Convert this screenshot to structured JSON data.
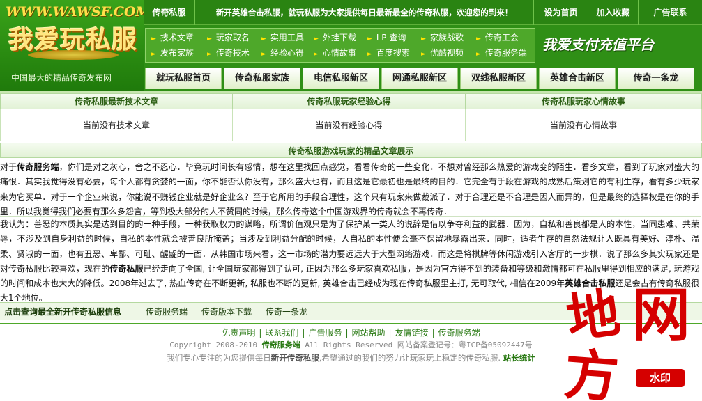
{
  "logo": {
    "url_text": "WWW.WAWSF.COM",
    "title": "我爱玩私服",
    "slogan": "中国最大的精品传奇发布网"
  },
  "topbar": {
    "site_label": "传奇私服",
    "welcome": "新开英雄合击私服，就玩私服为大家提供每日最新最全的传奇私服，欢迎您的到来！",
    "set_home": "设为首页",
    "add_favorite": "加入收藏",
    "ad_contact": "广告联系"
  },
  "nav": {
    "row1": [
      "技术文章",
      "玩家取名",
      "实用工具",
      "外挂下载",
      "I P 查询",
      "家族战歌",
      "传奇工会"
    ],
    "row2": [
      "发布家族",
      "传奇技术",
      "经验心得",
      "心情故事",
      "百度搜索",
      "优酷视频",
      "传奇服务端"
    ]
  },
  "pay_banner": "我爱支付充值平台",
  "tabs": [
    "就玩私服首页",
    "传奇私服家族",
    "电信私服新区",
    "网通私服新区",
    "双线私服新区",
    "英雄合击新区",
    "传奇一条龙"
  ],
  "columns": [
    {
      "title": "传奇私服最新技术文章",
      "empty": "当前没有技术文章"
    },
    {
      "title": "传奇私服玩家经验心得",
      "empty": "当前没有经验心得"
    },
    {
      "title": "传奇私服玩家心情故事",
      "empty": "当前没有心情故事"
    }
  ],
  "showcase": {
    "title": "传奇私服游戏玩家的精品文章展示",
    "para1_prefix": "对于",
    "para1_bold": "传奇服务端",
    "para1_rest": "，你们是对之灰心，舍之不忍心．毕竟玩时间长有感情，想在这里找回点感觉，看看传奇的一些变化．不想对曾经那么热爱的游戏变的陌生．看多文章，看到了玩家对盛大的痛恨．其实我觉得没有必要，每个人都有贪婪的一面，你不能否认你没有，那么盛大也有，而且这是它最初也是最终的目的．它完全有手段在游戏的成熟后策划它的有利生存，看有多少玩家来为它买单．对于一个企业来说，你能说不赚钱企业就是好企业么？至于它所用的手段合理性，这个只有玩家来做裁派了．对于合理还是不合理是因人而异的，但是最终的选择权是在你的手里．所以我觉得我们必要有那么多怨言，等到极大部分的人不赞同的时候，那么传奇这个中国游戏界的传奇就会不再传奇．",
    "para2_a": "我认为：善恶的本质其实是达到目的的一种手段，一种获取权力的谋略，所谓价值观只是为了保护某一类人的说辞是借以争夺利益的武器．因为，自私和善良都是人的本性，当同患难、共荣辱，不涉及到自身利益的时候，自私的本性就会被善良所掩盖；当涉及到利益分配的时候，人自私的本性便会毫不保留地暴露出来．同时，适者生存的自然法规让人既具有美好、淳朴、温柔、贤淑的一面，也有丑恶、卑鄙、可耻、龌龊的一面．从韩国市场来看，这一市场的潜力要远远大于大型网络游戏．而这是将棋牌等休闲游戏引入客厅的一步棋．说了那么多其实玩家还是对传奇私服比较喜欢，现在的",
    "para2_bold1": "传奇私服",
    "para2_b": "已经走向了全国, 让全国玩家都得到了认可, 正因为那么多玩家喜欢私服，是因为官方得不到的装备和等级和激情都可在私服里得到相应的满足, 玩游戏的时间和成本也大大的降低。2008年过去了, 热血传奇在不断更新, 私服也不断的更新, 英雄合击已经成为现在传奇私服里主打, 无可取代, 相信在2009年",
    "para2_bold2": "英雄合击私服",
    "para2_c": "还是会占有传奇私服很大1个地位。"
  },
  "query_bar": {
    "title": "点击查询最全新开传奇私服信息",
    "links": [
      "传奇服务端",
      "传奇版本下载",
      "传奇一条龙"
    ]
  },
  "footer": {
    "links": [
      "免责声明",
      "联系我们",
      "广告服务",
      "网站帮助",
      "友情链接",
      "传奇服务端"
    ],
    "copyright_prefix": "Copyright 2008-2010",
    "copyright_brand": "传奇服务端",
    "copyright_rest": "All Rights Reserved 网站备案登记号：粤ICP备05092447号",
    "support_a": "我们专心专注的为您提供每日",
    "support_bold": "新开传奇私服",
    "support_b": ",希望通过的我们的努力让玩家玩上稳定的传奇私服.",
    "stats_link": "站长统计"
  },
  "watermark": {
    "chars": [
      "地",
      "网",
      "方"
    ],
    "stamp": "水印"
  },
  "colors": {
    "header_green": "#2f8f16",
    "accent_yellow": "#ffe400",
    "link_green": "#2a7a14",
    "watermark_red": "#d50000"
  }
}
